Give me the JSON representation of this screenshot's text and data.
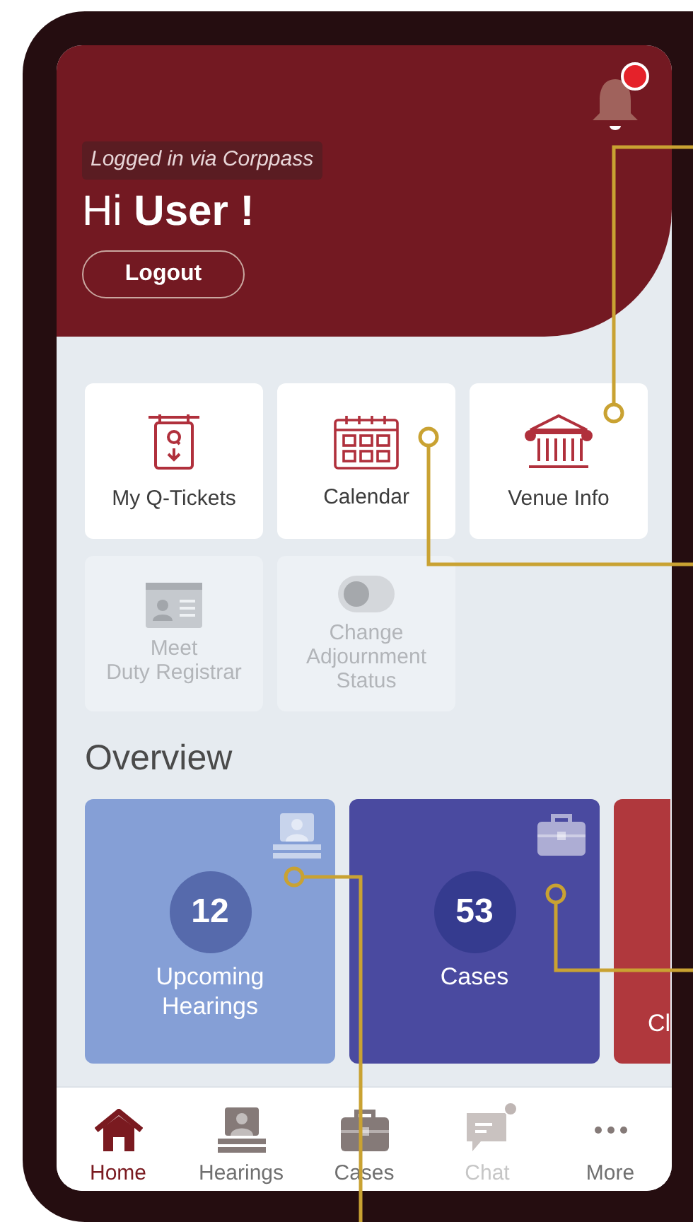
{
  "header": {
    "login_note": "Logged in via Corppass",
    "greeting": "Hi",
    "user": "User !",
    "logout": "Logout",
    "notification_dot": true
  },
  "tiles": [
    {
      "label": "My Q-Tickets",
      "kind": "ticket",
      "disabled": false
    },
    {
      "label": "Calendar",
      "kind": "calendar",
      "disabled": false
    },
    {
      "label": "Venue Info",
      "kind": "building",
      "disabled": false
    },
    {
      "label": "Meet\nDuty Registrar",
      "kind": "idcard",
      "disabled": true
    },
    {
      "label": "Change\nAdjournment\nStatus",
      "kind": "toggle",
      "disabled": true
    }
  ],
  "overview": {
    "title": "Overview",
    "cards": [
      {
        "count": "12",
        "label": "Upcoming\nHearings",
        "kind": "hearing",
        "color": "#859fd6"
      },
      {
        "count": "53",
        "label": "Cases",
        "kind": "briefcase",
        "color": "#4a4aa0"
      },
      {
        "label": "Cl",
        "color": "#b0383d"
      }
    ]
  },
  "nav": [
    {
      "label": "Home",
      "kind": "home",
      "selected": true,
      "disabled": false,
      "badge": false
    },
    {
      "label": "Hearings",
      "kind": "hearing",
      "selected": false,
      "disabled": false,
      "badge": false
    },
    {
      "label": "Cases",
      "kind": "briefcase",
      "selected": false,
      "disabled": false,
      "badge": false
    },
    {
      "label": "Chat",
      "kind": "chat",
      "selected": false,
      "disabled": true,
      "badge": true
    },
    {
      "label": "More",
      "kind": "more",
      "selected": false,
      "disabled": false,
      "badge": false
    }
  ]
}
